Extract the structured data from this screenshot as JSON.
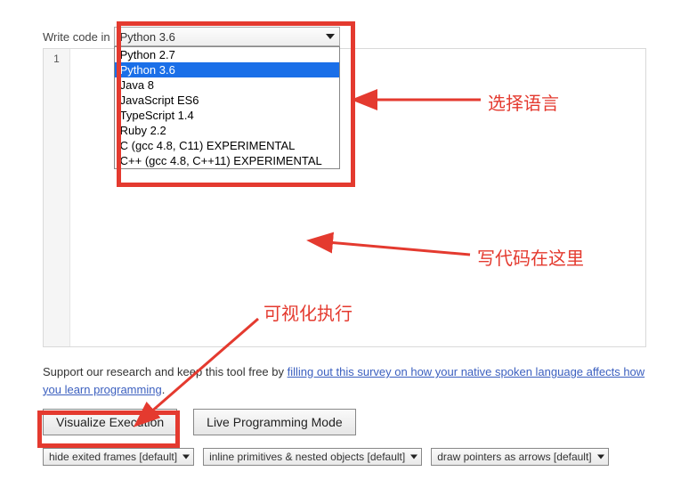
{
  "header": {
    "write_label": "Write code in"
  },
  "language_select": {
    "selected": "Python 3.6",
    "options": [
      "Python 2.7",
      "Python 3.6",
      "Java 8",
      "JavaScript ES6",
      "TypeScript 1.4",
      "Ruby 2.2",
      "C (gcc 4.8, C11) EXPERIMENTAL",
      "C++ (gcc 4.8, C++11) EXPERIMENTAL"
    ],
    "highlighted_index": 1
  },
  "editor": {
    "line_numbers": [
      "1"
    ]
  },
  "support": {
    "prefix": "Support our research and keep this tool free by ",
    "link_text": "filling out this survey on how your native spoken language affects how you learn programming",
    "suffix": "."
  },
  "buttons": {
    "visualize": "Visualize Execution",
    "live": "Live Programming Mode"
  },
  "option_selects": {
    "frames": "hide exited frames [default]",
    "primitives": "inline primitives & nested objects [default]",
    "pointers": "draw pointers as arrows [default]"
  },
  "annotations": {
    "select_language": "选择语言",
    "write_code_here": "写代码在这里",
    "visualize_execution": "可视化执行"
  }
}
